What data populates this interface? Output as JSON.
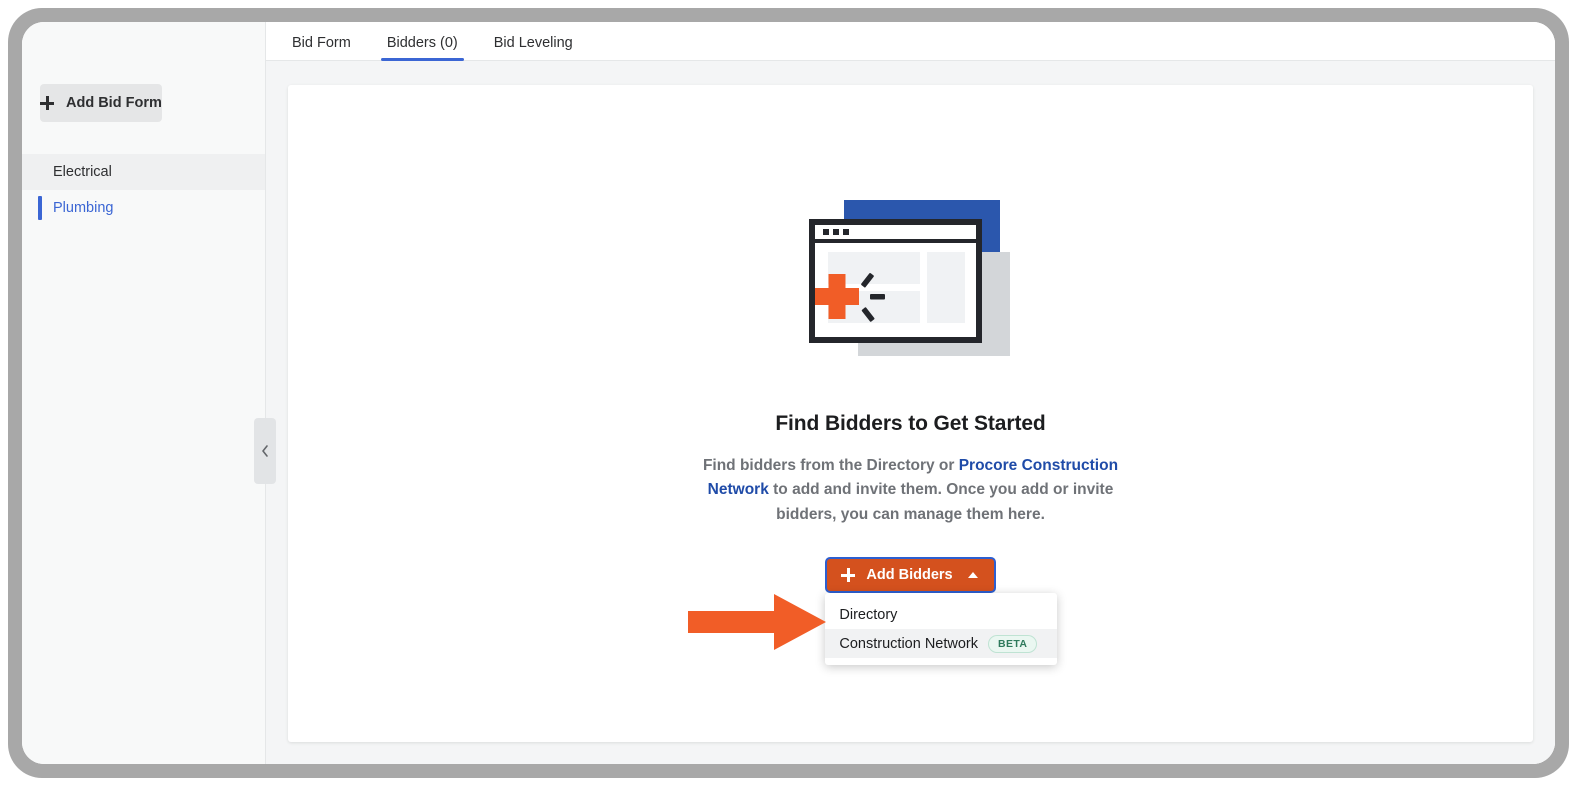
{
  "sidebar": {
    "add_bid_form_label": "Add Bid Form",
    "items": [
      {
        "label": "Electrical",
        "state": "hovered"
      },
      {
        "label": "Plumbing",
        "state": "selected"
      }
    ],
    "collapse_tooltip": "Collapse"
  },
  "tabs": [
    {
      "label": "Bid Form",
      "active": false
    },
    {
      "label": "Bidders (0)",
      "active": true
    },
    {
      "label": "Bid Leveling",
      "active": false
    }
  ],
  "empty_state": {
    "title": "Find Bidders to Get Started",
    "desc_part1": "Find bidders from the Directory or ",
    "desc_link": "Procore Construction Network",
    "desc_part2": " to add and invite them. Once you add or invite bidders, you can manage them here."
  },
  "add_bidders": {
    "label": "Add Bidders",
    "menu": [
      {
        "label": "Directory",
        "badge": null
      },
      {
        "label": "Construction Network",
        "badge": "BETA"
      }
    ]
  },
  "colors": {
    "accent_orange": "#d4511e",
    "accent_blue": "#3b66d4",
    "link_blue": "#1f4ba8",
    "badge_green_text": "#2f7a5c",
    "badge_green_bg": "#eaf7f1",
    "illustration_blue": "#2b57ad",
    "illustration_dark": "#24262b",
    "illustration_gray": "#d3d6d9",
    "annotation_orange": "#f15d27"
  }
}
